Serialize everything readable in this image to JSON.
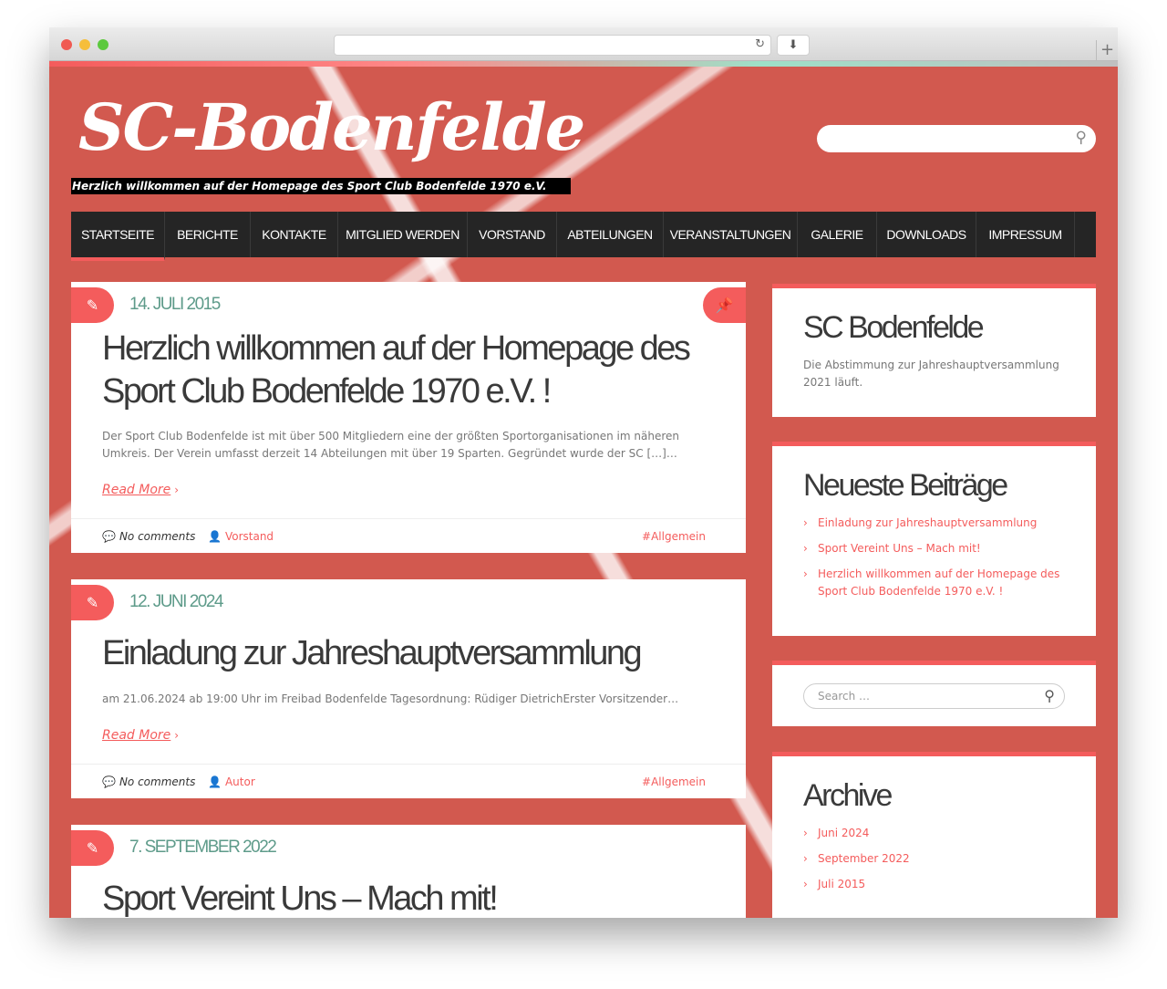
{
  "site": {
    "title": "SC-Bodenfelde",
    "tagline": "Herzlich willkommen auf der Homepage des Sport Club Bodenfelde 1970 e.V."
  },
  "nav": [
    "STARTSEITE",
    "BERICHTE",
    "KONTAKTE",
    "MITGLIED WERDEN",
    "VORSTAND",
    "ABTEILUNGEN",
    "VERANSTALTUNGEN",
    "GALERIE",
    "DOWNLOADS",
    "IMPRESSUM"
  ],
  "posts": [
    {
      "date": "14. JULI 2015",
      "title": "Herzlich willkommen auf der Homepage des Sport Club Bodenfelde 1970 e.V. !",
      "excerpt": "Der Sport Club Bodenfelde ist mit über 500 Mitgliedern eine der größten Sportorganisationen im näheren Umkreis. Der Verein umfasst derzeit 14 Abteilungen mit über 19 Sparten. Gegründet wurde der SC […]…",
      "more": "Read More",
      "comments": "No comments",
      "author": "Vorstand",
      "tag": "#Allgemein"
    },
    {
      "date": "12. JUNI 2024",
      "title": "Einladung zur Jahreshauptversammlung",
      "excerpt": "am 21.06.2024 ab 19:00 Uhr im Freibad Bodenfelde Tagesordnung: Rüdiger DietrichErster Vorsitzender…",
      "more": "Read More",
      "comments": "No comments",
      "author": "Autor",
      "tag": "#Allgemein"
    },
    {
      "date": "7. SEPTEMBER 2022",
      "title": "Sport Vereint Uns – Mach mit!"
    }
  ],
  "sidebar": {
    "about": {
      "title": "SC Bodenfelde",
      "text": "Die Abstimmung zur Jahreshauptversammlung 2021 läuft."
    },
    "recent": {
      "title": "Neueste Beiträge",
      "items": [
        "Einladung zur Jahreshauptversammlung",
        "Sport Vereint Uns – Mach mit!",
        "Herzlich willkommen auf der Homepage des Sport Club Bodenfelde 1970 e.V. !"
      ]
    },
    "search": {
      "placeholder": "Search …"
    },
    "archive": {
      "title": "Archive",
      "items": [
        "Juni 2024",
        "September 2022",
        "Juli 2015"
      ]
    }
  },
  "colors": {
    "accent": "#f45c5c",
    "date": "#5e9b8a",
    "nav_bg": "#252525"
  }
}
